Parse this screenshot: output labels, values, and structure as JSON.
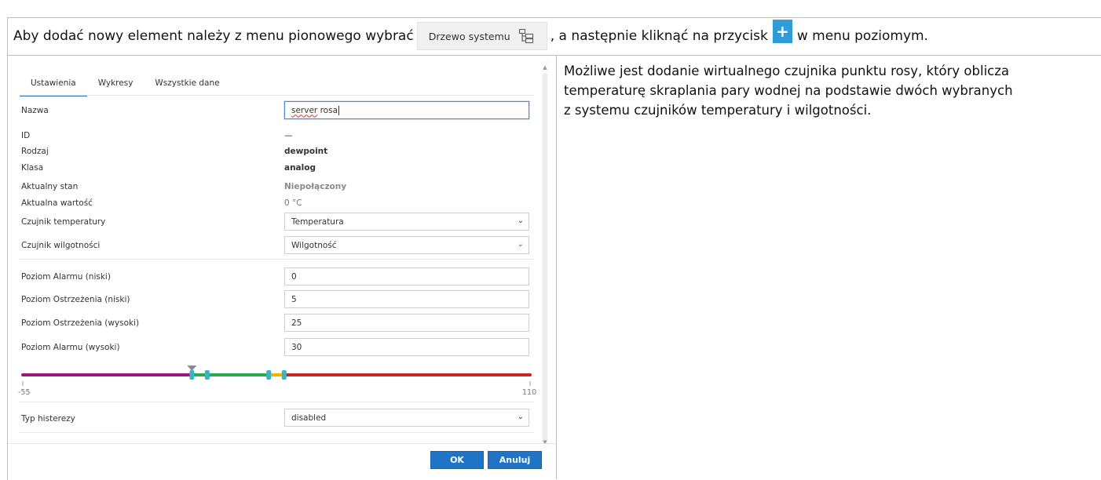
{
  "instruction": {
    "part1": "Aby dodać nowy element należy z menu pionowego wybrać",
    "tree_button_label": "Drzewo systemu",
    "tree_button_icon": "tree-icon",
    "part2": ", a następnie kliknąć na przycisk",
    "plus_icon": "plus-icon",
    "part3": "w menu poziomym."
  },
  "description": {
    "line1": "Możliwe jest dodanie wirtualnego czujnika punktu rosy, który oblicza",
    "line2": "temperaturę skraplania pary wodnej na podstawie dwóch wybranych",
    "line3": "z systemu czujników temperatury i wilgotności."
  },
  "dialog": {
    "tabs": [
      {
        "label": "Ustawienia",
        "active": true
      },
      {
        "label": "Wykresy",
        "active": false
      },
      {
        "label": "Wszystkie dane",
        "active": false
      }
    ],
    "fields": {
      "name": {
        "label": "Nazwa",
        "value_word": "server",
        "value_rest": " rosa"
      },
      "id": {
        "label": "ID",
        "value": "—"
      },
      "type": {
        "label": "Rodzaj",
        "value": "dewpoint"
      },
      "class": {
        "label": "Klasa",
        "value": "analog"
      },
      "state": {
        "label": "Aktualny stan",
        "value": "Niepołączony"
      },
      "current_value": {
        "label": "Aktualna wartość",
        "value": "0 °C"
      },
      "temp_sensor": {
        "label": "Czujnik temperatury",
        "value": "Temperatura"
      },
      "humidity_sensor": {
        "label": "Czujnik wilgotności",
        "value": "Wilgotność"
      },
      "alarm_low": {
        "label": "Poziom Alarmu (niski)",
        "value": "0"
      },
      "warning_low": {
        "label": "Poziom Ostrzeżenia (niski)",
        "value": "5"
      },
      "warning_high": {
        "label": "Poziom Ostrzeżenia (wysoki)",
        "value": "25"
      },
      "alarm_high": {
        "label": "Poziom Alarmu (wysoki)",
        "value": "30"
      },
      "hysteresis": {
        "label": "Typ histerezy",
        "value": "disabled"
      }
    },
    "slider": {
      "min_label": "-55",
      "max_label": "110",
      "min": -55,
      "max": 110,
      "current": 0,
      "handles": [
        0,
        5,
        25,
        30
      ],
      "colors": {
        "alarm": "#a0167a",
        "ok": "#2aa84a",
        "warning": "#f0b400",
        "danger": "#c62828",
        "handle": "#3bb5c6",
        "marker": "#8a8a8a"
      }
    },
    "buttons": {
      "ok": "OK",
      "cancel": "Anuluj"
    }
  }
}
